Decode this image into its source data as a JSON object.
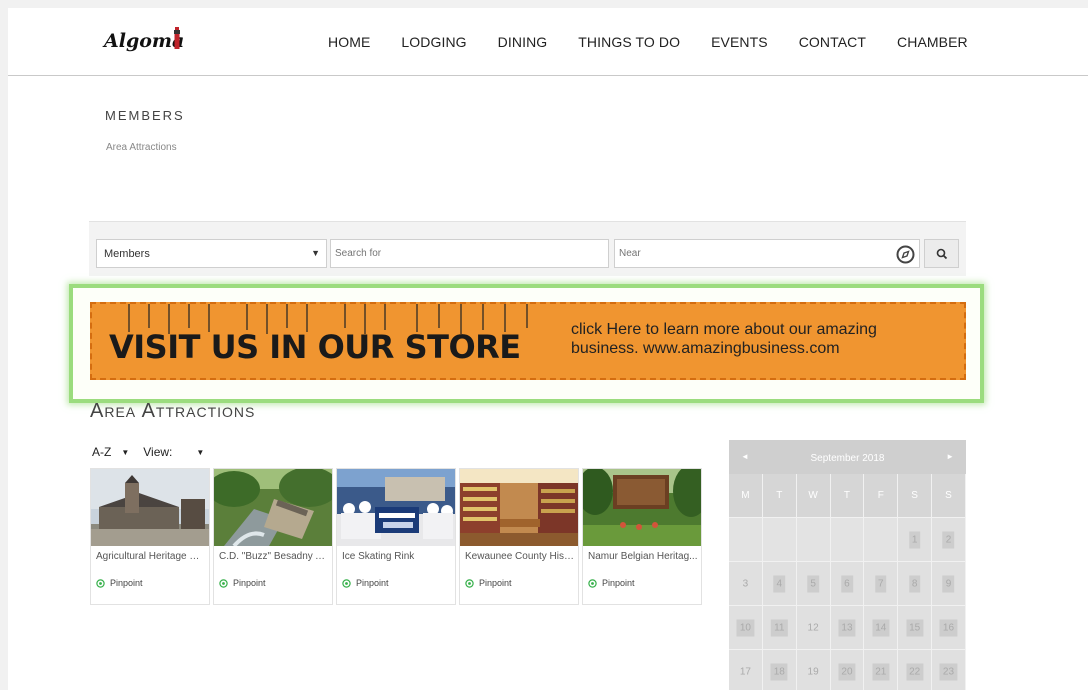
{
  "brand": {
    "name": "Algoma"
  },
  "nav": [
    "HOME",
    "LODGING",
    "DINING",
    "THINGS TO DO",
    "EVENTS",
    "CONTACT",
    "CHAMBER"
  ],
  "page": {
    "title": "MEMBERS",
    "breadcrumb": "Area Attractions"
  },
  "search": {
    "category": "Members",
    "search_placeholder": "Search for",
    "near_placeholder": "Near"
  },
  "banner": {
    "headline": "VISIT US IN OUR STORE",
    "text_line1": "click Here to learn more about our amazing",
    "text_line2": "business.  www.amazingbusiness.com",
    "colors": {
      "background": "#f09530",
      "highlight": "#9bdc7e"
    }
  },
  "listing": {
    "title": "Area Attractions",
    "sort": "A-Z",
    "view_label": "View:",
    "cards": [
      {
        "name": "Agricultural Heritage Ce...",
        "link": "Pinpoint"
      },
      {
        "name": "C.D. \"Buzz\" Besadny An...",
        "link": "Pinpoint"
      },
      {
        "name": "Ice Skating Rink",
        "link": "Pinpoint"
      },
      {
        "name": "Kewaunee County Histo...",
        "link": "Pinpoint"
      },
      {
        "name": "Namur Belgian Heritag...",
        "link": "Pinpoint"
      }
    ]
  },
  "calendar": {
    "month": "September 2018",
    "prev": "◄",
    "next": "►",
    "dow": [
      "M",
      "T",
      "W",
      "T",
      "F",
      "S",
      "S"
    ],
    "weeks": [
      [
        "",
        "",
        "",
        "",
        "",
        "1",
        "2"
      ],
      [
        "3",
        "4",
        "5",
        "6",
        "7",
        "8",
        "9"
      ],
      [
        "10",
        "11",
        "12",
        "13",
        "14",
        "15",
        "16"
      ],
      [
        "17",
        "18",
        "19",
        "20",
        "21",
        "22",
        "23"
      ]
    ],
    "highlighted": [
      "1",
      "2",
      "4",
      "5",
      "6",
      "7",
      "8",
      "9",
      "10",
      "11",
      "13",
      "14",
      "15",
      "16",
      "18",
      "20",
      "21",
      "22",
      "23"
    ]
  }
}
